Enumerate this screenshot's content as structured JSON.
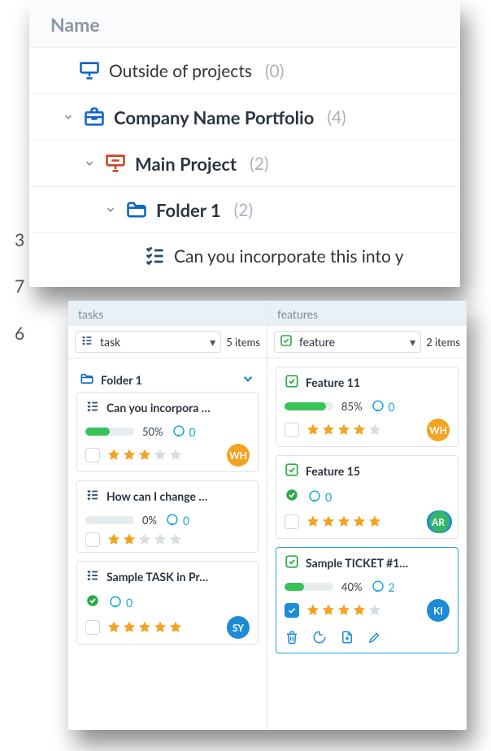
{
  "tree": {
    "header": "Name",
    "rows": [
      {
        "label": "Outside of projects",
        "count": "(0)"
      },
      {
        "label": "Company Name  Portfolio",
        "count": "(4)"
      },
      {
        "label": "Main Project",
        "count": "(2)"
      },
      {
        "label": "Folder 1",
        "count": "(2)"
      },
      {
        "label": "Can you incorporate this into y"
      }
    ],
    "edge_numbers": [
      "3",
      "7",
      "6"
    ]
  },
  "kanban": {
    "columns": [
      {
        "header": "tasks",
        "filter_label": "task",
        "items_count": "5 items",
        "folder_label": "Folder 1",
        "cards": [
          {
            "title": "Can you incorpora …",
            "percent": "50%",
            "progress": 50,
            "done": false,
            "comments": "0",
            "stars": 3,
            "avatar": "WH",
            "avatar_color": "#f2a421",
            "checked": false
          },
          {
            "title": "How can I change  …",
            "percent": "0%",
            "progress": 0,
            "done": false,
            "comments": "0",
            "stars": 2,
            "avatar": "",
            "avatar_color": "",
            "checked": false
          },
          {
            "title": "Sample TASK in Pr…",
            "percent": "",
            "progress": 100,
            "done": true,
            "comments": "0",
            "stars": 5,
            "avatar": "SY",
            "avatar_color": "#1d8bd6",
            "checked": false
          }
        ]
      },
      {
        "header": "features",
        "filter_label": "feature",
        "items_count": "2 items",
        "cards": [
          {
            "title": "Feature 11",
            "percent": "85%",
            "progress": 85,
            "done": false,
            "comments": "0",
            "stars": 4,
            "avatar": "WH",
            "avatar_color": "#f2a421",
            "checked": false
          },
          {
            "title": "Feature 15",
            "percent": "",
            "progress": 100,
            "done": true,
            "comments": "0",
            "stars": 5,
            "avatar": "AR",
            "avatar_color": "#34b56a",
            "avatar_ring": "#1d8bd6",
            "checked": false
          },
          {
            "title": "Sample TICKET #1…",
            "percent": "40%",
            "progress": 40,
            "done": false,
            "comments": "2",
            "stars": 4,
            "avatar": "KI",
            "avatar_color": "#1d8bd6",
            "checked": true,
            "selected": true,
            "actions": true
          }
        ]
      }
    ]
  }
}
